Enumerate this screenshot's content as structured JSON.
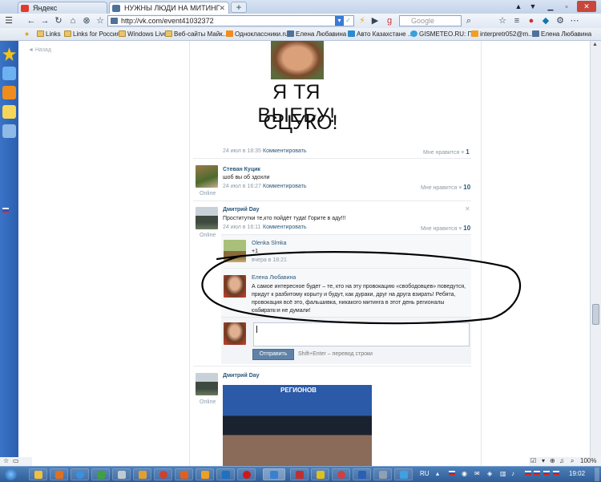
{
  "browser": {
    "tabs": [
      {
        "label": "Яндекс",
        "active": false
      },
      {
        "label": "НУЖНЫ ЛЮДИ НА МИТИНГ",
        "active": true
      }
    ],
    "new_tab_label": "+",
    "url": "http://vk.com/event41032372",
    "search_placeholder": "Google",
    "bookmarks": [
      "Links",
      "Links for Россия",
      "Windows Live",
      "Веб-сайты Майк...",
      "Одноклассники.ru",
      "Елена Любавина",
      "Авто Казахстане ...",
      "GISMETEO.RU: П...",
      "interpretr052@m...",
      "Елена Любавина"
    ]
  },
  "page": {
    "back_link": "◄ Назад",
    "post_image_text_line1": "Я ТЯ ВЫЕБУ!",
    "post_image_text_line2": "СЦУКО!",
    "first_post_meta": {
      "date": "24 июл в 18:35",
      "comment": "Комментировать",
      "like_label": "Мне нравится",
      "like_count": "1"
    },
    "posts": [
      {
        "author": "Стеван Куцик",
        "text": "шоб вы об здохли",
        "date": "24 июл в 16:27",
        "comment": "Комментировать",
        "like_label": "Мне нравится",
        "like_count": "10",
        "status": "Online"
      },
      {
        "author": "Дмитрий Day",
        "text": "Проститутки те,кто пойдёт туда! Горите в аду!!!",
        "date": "24 июл в 16:11",
        "comment": "Комментировать",
        "like_label": "Мне нравится",
        "like_count": "10",
        "status": "Online",
        "close_glyph": "✕"
      }
    ],
    "comments": [
      {
        "author": "Olenka Slmka",
        "text": "+1",
        "date": "вчера в 18:21"
      },
      {
        "author": "Елена Любавина",
        "text": "А самое интересное будет – те, кто на эту провокацию «свободовцев» поведутся, придут к разбитому корыту и будут, как дураки, друг на друга взирать! Ребята, провокация всё это, фальшивка, никакого митинга в этот день регионалы собирать и не думали!",
        "date": "только что"
      }
    ],
    "reply": {
      "send_label": "Отправить",
      "hint": "Shift+Enter – перевод строки"
    },
    "last_post": {
      "author": "Дмитрий Day",
      "status": "Online",
      "image_text": "РЕГИОНОВ"
    }
  },
  "taskbar": {
    "language": "RU",
    "clock": "19:02",
    "zoom": "100%"
  },
  "colors": {
    "link": "#2b587a",
    "sidebar": "#2c5fb0",
    "taskbar": "#2f5d97",
    "send_button": "#5e82a8"
  }
}
